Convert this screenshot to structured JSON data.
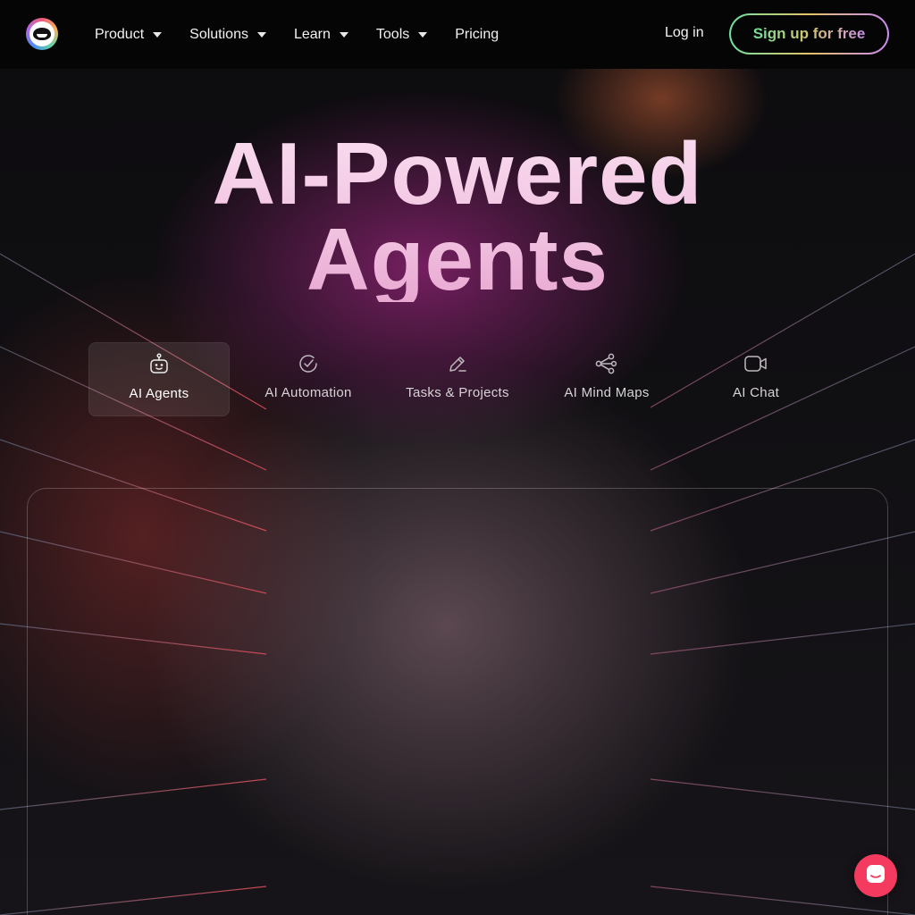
{
  "header": {
    "nav": [
      {
        "label": "Product",
        "dropdown": true
      },
      {
        "label": "Solutions",
        "dropdown": true
      },
      {
        "label": "Learn",
        "dropdown": true
      },
      {
        "label": "Tools",
        "dropdown": true
      },
      {
        "label": "Pricing",
        "dropdown": false
      }
    ],
    "login_label": "Log in",
    "signup_label": "Sign up for free"
  },
  "hero": {
    "title_line1": "AI-Powered",
    "title_line2": "Agents"
  },
  "tabs": [
    {
      "label": "AI Agents",
      "icon": "robot-icon",
      "active": true
    },
    {
      "label": "AI Automation",
      "icon": "check-circle-icon",
      "active": false
    },
    {
      "label": "Tasks & Projects",
      "icon": "pencil-icon",
      "active": false
    },
    {
      "label": "AI Mind Maps",
      "icon": "share-nodes-icon",
      "active": false
    },
    {
      "label": "AI Chat",
      "icon": "video-icon",
      "active": false
    }
  ],
  "colors": {
    "accent_chat": "#f43a5f",
    "hero_glow": "#7a2064",
    "signup_gradient": [
      "#6ee0a0",
      "#e6c36a",
      "#c88af0"
    ]
  }
}
